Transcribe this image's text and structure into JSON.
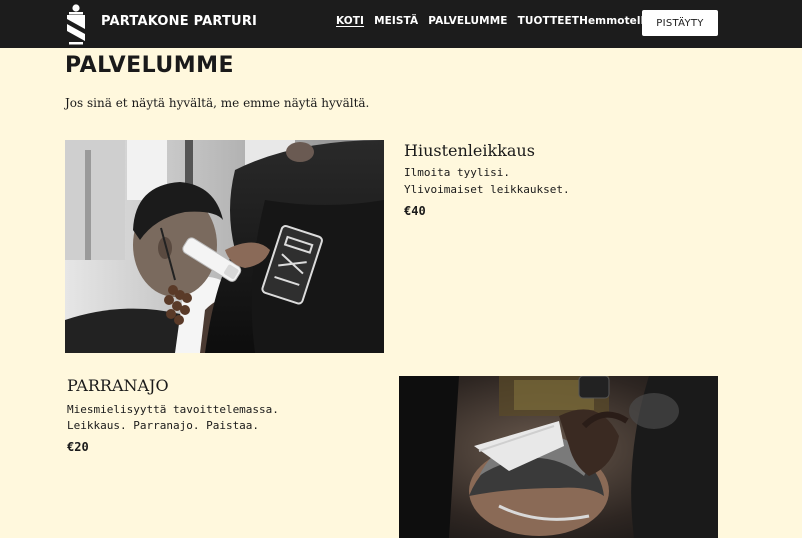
{
  "brand": {
    "name": "PARTAKONE PARTURI"
  },
  "nav": {
    "items": [
      "KOTI",
      "MEISTÄ",
      "PALVELUMME",
      "TUOTTEET",
      "Hemmotella"
    ],
    "active": "KOTI"
  },
  "cta": {
    "label": "PISTÄYTY"
  },
  "page": {
    "title": "PALVELUMME",
    "subtitle": "Jos sinä et näytä hyvältä, me emme näytä hyvältä."
  },
  "services": [
    {
      "title": "Hiustenleikkaus",
      "lines": [
        "Ilmoita tyylisi.",
        "Ylivoimaiset leikkaukset."
      ],
      "price": "€40",
      "image": "barber-haircut-photo"
    },
    {
      "title": "PARRANAJO",
      "lines": [
        "Miesmielisyyttä tavoittelemassa.",
        "Leikkaus. Parranajo. Paistaa."
      ],
      "price": "€20",
      "image": "barber-shave-photo"
    }
  ],
  "colors": {
    "header_bg": "#1c1c1c",
    "page_bg": "#fff8dd",
    "text": "#1a1a1a",
    "cta_bg": "#ffffff"
  }
}
